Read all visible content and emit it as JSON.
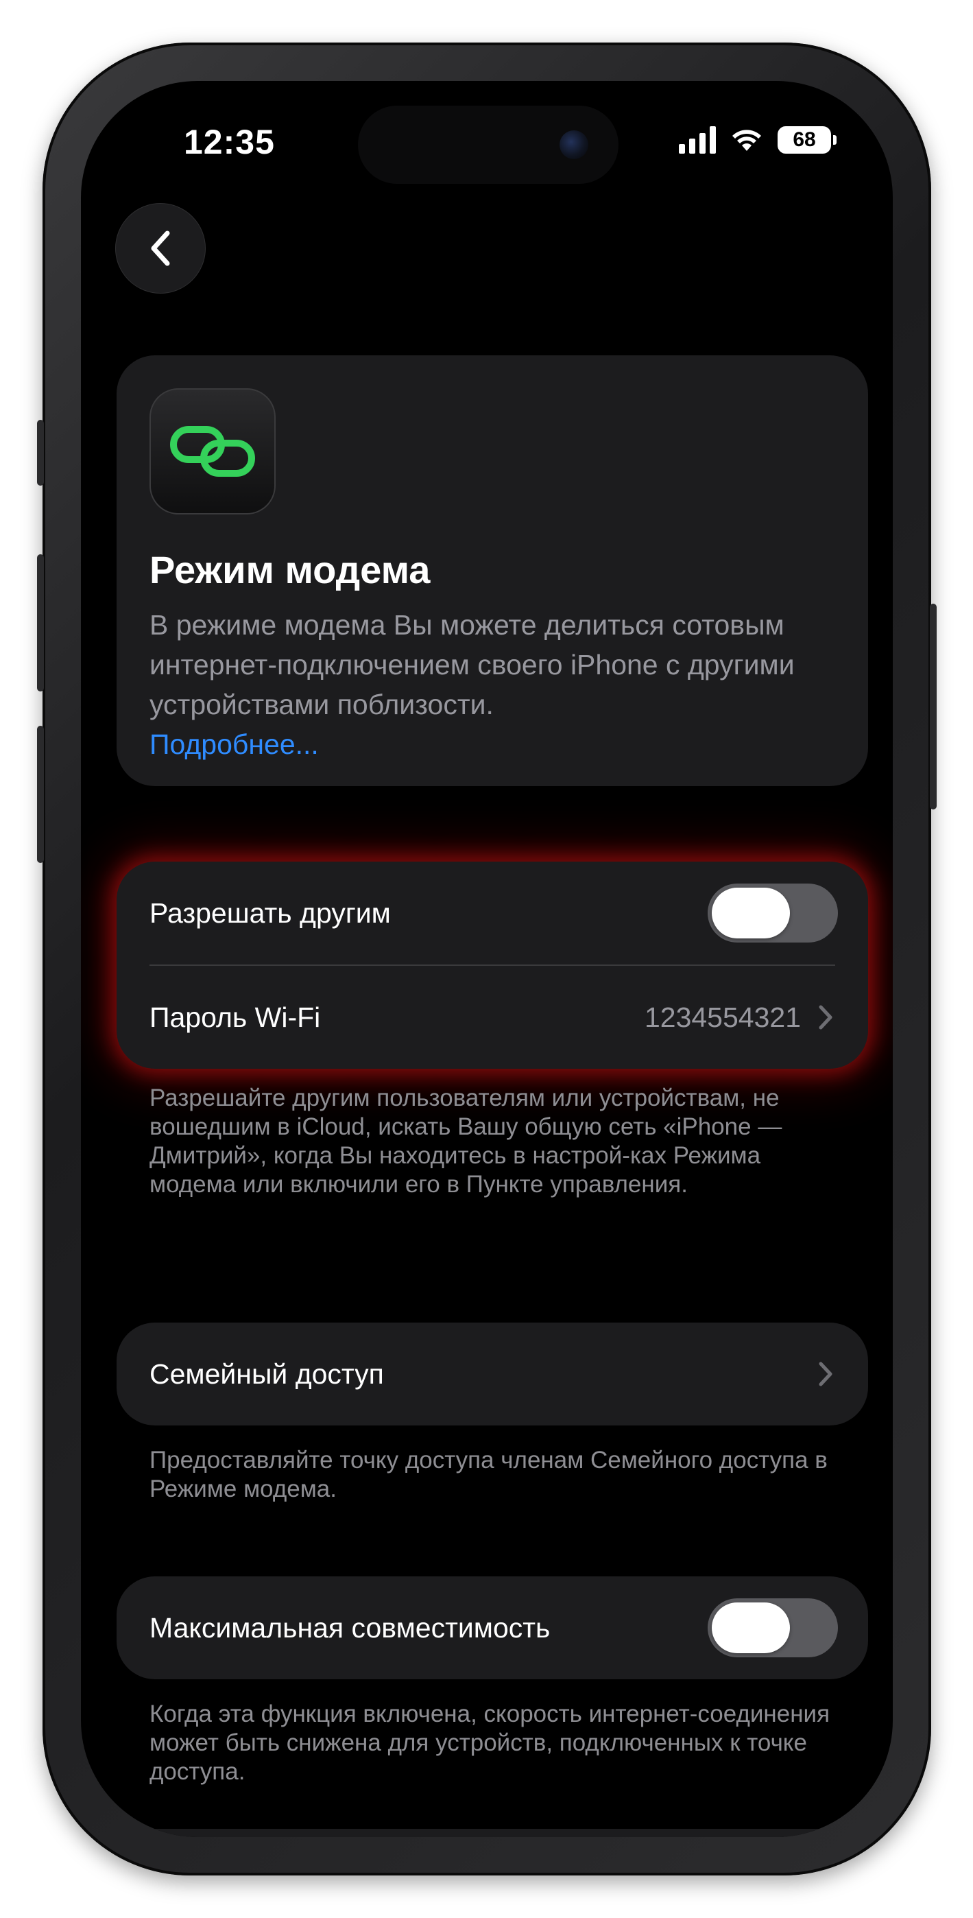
{
  "status_bar": {
    "time": "12:35",
    "battery": "68"
  },
  "hero": {
    "icon": "link-icon",
    "icon_color": "#34d15a",
    "title": "Режим модема",
    "description": "В режиме модема Вы можете делиться сотовым интернет-подключением своего iPhone с другими устройствами поблизости.",
    "link": "Подробнее..."
  },
  "sharing_group": {
    "allow_others": {
      "label": "Разрешать другим",
      "on": false
    },
    "wifi_password": {
      "label": "Пароль Wi-Fi",
      "value": "1234554321"
    },
    "footnote": "Разрешайте другим пользователям или устройствам, не вошедшим в iCloud, искать Вашу общую сеть «iPhone — Дмитрий», когда Вы находитесь в настрой-ках Режима модема или включили его в Пункте управления."
  },
  "family": {
    "label": "Семейный доступ",
    "footnote": "Предоставляйте точку доступа членам Семейного доступа в Режиме модема."
  },
  "compatibility": {
    "label": "Максимальная совместимость",
    "on": false,
    "footnote": "Когда эта функция включена, скорость интернет-соединения может быть снижена для устройств, подключенных к точке доступа."
  },
  "colors": {
    "background": "#000000",
    "card": "#1c1c1e",
    "link": "#2f8cff",
    "highlight_glow": "#d21414"
  }
}
